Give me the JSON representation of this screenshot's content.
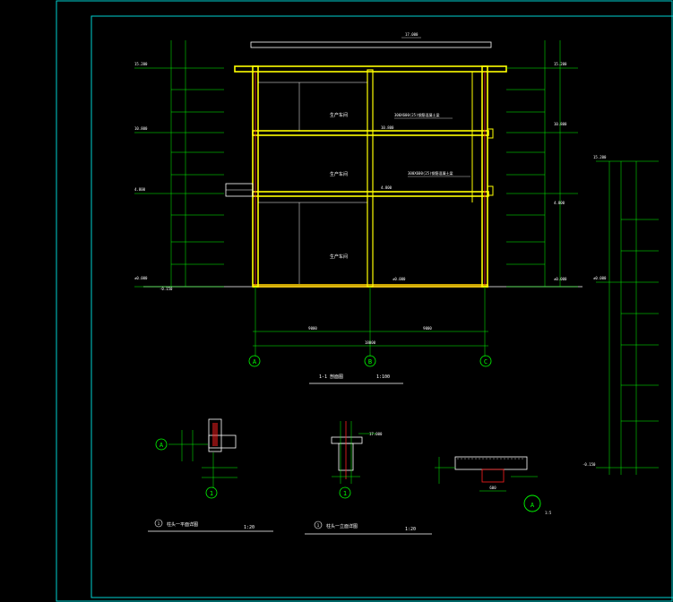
{
  "colors": {
    "background": "#000000",
    "frame": "#00d0d0",
    "wall": "#ffff00",
    "slab": "#ffff00",
    "dimension": "#00ff00",
    "axis": "#00ff00",
    "text": "#ffffff",
    "column_rebar": "#ff2020",
    "ground": "#ffd000"
  },
  "section": {
    "roof_elevation": "17.000",
    "levels_left": [
      "15.200",
      "10.800",
      "4.800",
      "±0.000"
    ],
    "levels_right": [
      "15.200",
      "10.800",
      "4.800",
      "±0.000"
    ],
    "level_outside_left": "-0.150",
    "room_labels": [
      "生产车间",
      "生产车间",
      "生产车间"
    ],
    "beam_notes": [
      "300X600(25)钢筋混凝土梁",
      "300X600(25)钢筋混凝土梁"
    ],
    "slab_levels": [
      "10.800",
      "4.800",
      "±0.000"
    ],
    "span_left": "9000",
    "span_right": "9000",
    "span_total": "18000",
    "axes": [
      "A",
      "B",
      "C"
    ],
    "title": "1-1 剖面图",
    "scale": "1:100"
  },
  "side_elevation": {
    "top_level": "15.200",
    "bottom_level": "-0.150",
    "mid_level": "±0.000"
  },
  "details": {
    "detail1_title": "柱头一平面详图",
    "detail1_scale": "1:20",
    "detail1_number": "1",
    "detail2_title": "柱头一立面详图",
    "detail2_scale": "1:20",
    "detail2_number": "1",
    "callout_a_letter": "A",
    "callout_a_scale": "1:5",
    "callout_a_ref": "A",
    "detail2_level": "17.000",
    "detail3_dim": "600"
  }
}
